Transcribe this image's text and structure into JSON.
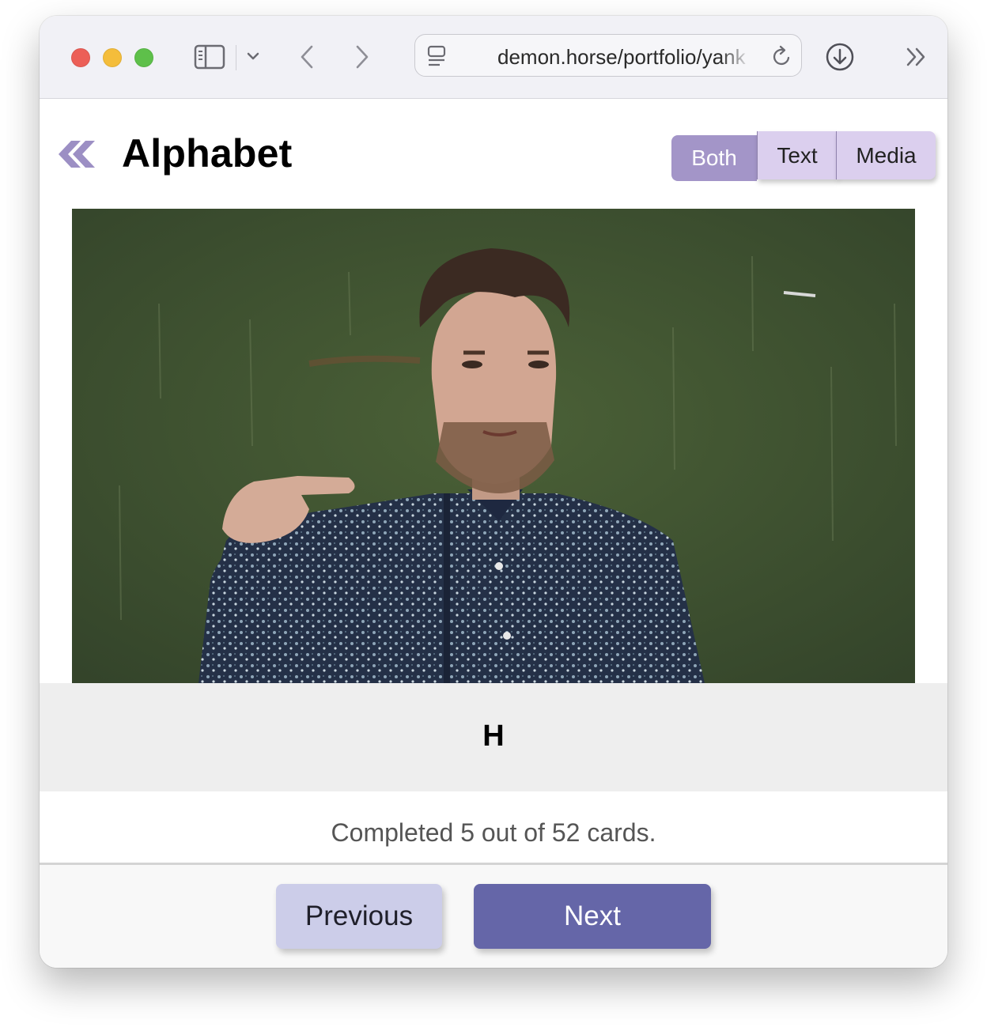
{
  "browser": {
    "url": "demon.horse/portfolio/yank",
    "icons": [
      "sidebar-icon",
      "chevron-down-icon",
      "back-icon",
      "forward-icon",
      "page-menu-icon",
      "reload-icon",
      "download-icon",
      "more-icon"
    ]
  },
  "header": {
    "back_icon": "double-chevron-left-icon",
    "title": "Alphabet"
  },
  "view_toggle": {
    "options": [
      "Both",
      "Text",
      "Media"
    ],
    "selected": "Both"
  },
  "card": {
    "media": "video-frame-person-signing",
    "answer": "H"
  },
  "progress": {
    "text": "Completed 5 out of 52 cards.",
    "completed": 5,
    "total": 52
  },
  "footer": {
    "previous_label": "Previous",
    "next_label": "Next"
  },
  "colors": {
    "accent": "#a395c8",
    "toggle_bg": "#dbcfee",
    "next_button": "#6566a8",
    "previous_button": "#cccde9",
    "answer_band": "#eeeeee"
  }
}
